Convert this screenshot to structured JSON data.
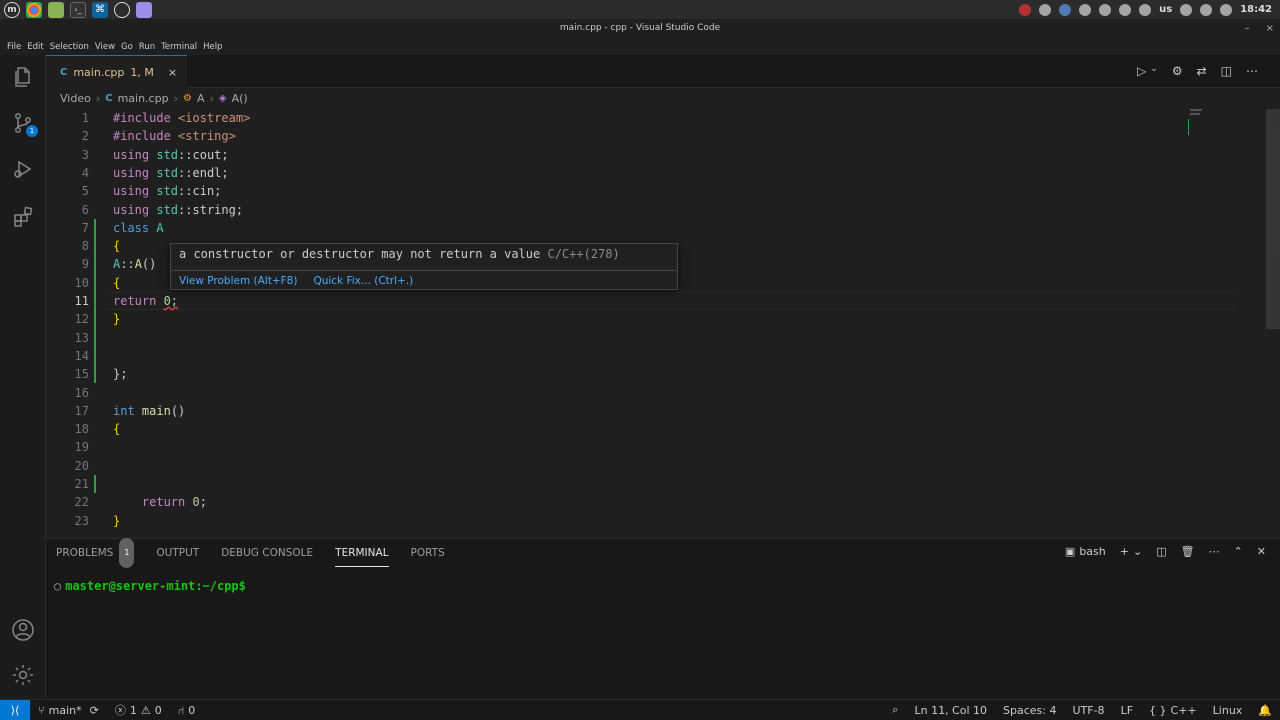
{
  "os_panel": {
    "clock": "18:42",
    "keyboard_layout": "us",
    "apps": [
      "mint-menu-icon",
      "chrome-icon",
      "files-icon",
      "terminal-icon",
      "vscode-icon",
      "obs-icon",
      "notes-icon"
    ]
  },
  "window": {
    "title": "main.cpp - cpp - Visual Studio Code",
    "minimize": "–",
    "close": "×"
  },
  "menu": [
    "File",
    "Edit",
    "Selection",
    "View",
    "Go",
    "Run",
    "Terminal",
    "Help"
  ],
  "activity": {
    "scm_badge": "1",
    "items": [
      "explorer",
      "source-control",
      "run-and-debug",
      "extensions",
      "accounts",
      "manage"
    ]
  },
  "tab": {
    "icon": "C",
    "label": "main.cpp",
    "status": "1, M",
    "close": "×"
  },
  "breadcrumb": {
    "folder": "Video",
    "file": "main.cpp",
    "class": "A",
    "method": "A()"
  },
  "code": {
    "current_line": 11,
    "lines": [
      {
        "n": "1",
        "tokens": [
          {
            "t": "#include ",
            "c": "kw"
          },
          {
            "t": "<iostream>",
            "c": "str"
          }
        ]
      },
      {
        "n": "2",
        "tokens": [
          {
            "t": "#include ",
            "c": "kw"
          },
          {
            "t": "<string>",
            "c": "str"
          }
        ]
      },
      {
        "n": "3",
        "tokens": [
          {
            "t": "using ",
            "c": "kw"
          },
          {
            "t": "std",
            "c": "ns"
          },
          {
            "t": "::cout;",
            "c": "pun"
          }
        ]
      },
      {
        "n": "4",
        "tokens": [
          {
            "t": "using ",
            "c": "kw"
          },
          {
            "t": "std",
            "c": "ns"
          },
          {
            "t": "::endl;",
            "c": "pun"
          }
        ]
      },
      {
        "n": "5",
        "tokens": [
          {
            "t": "using ",
            "c": "kw"
          },
          {
            "t": "std",
            "c": "ns"
          },
          {
            "t": "::cin;",
            "c": "pun"
          }
        ]
      },
      {
        "n": "6",
        "tokens": [
          {
            "t": "using ",
            "c": "kw"
          },
          {
            "t": "std",
            "c": "ns"
          },
          {
            "t": "::string;",
            "c": "pun"
          }
        ]
      },
      {
        "n": "7",
        "tokens": [
          {
            "t": "class ",
            "c": "kw2"
          },
          {
            "t": "A",
            "c": "ns"
          }
        ]
      },
      {
        "n": "8",
        "tokens": [
          {
            "t": "{",
            "c": "br"
          }
        ]
      },
      {
        "n": "9",
        "tokens": [
          {
            "t": "A",
            "c": "ns"
          },
          {
            "t": "::",
            "c": "pun"
          },
          {
            "t": "A",
            "c": "fn"
          },
          {
            "t": "()",
            "c": "pun"
          }
        ]
      },
      {
        "n": "10",
        "tokens": [
          {
            "t": "{",
            "c": "br"
          }
        ]
      },
      {
        "n": "11",
        "tokens": [
          {
            "t": "return ",
            "c": "kw"
          },
          {
            "t": "0;",
            "c": "num"
          }
        ]
      },
      {
        "n": "12",
        "tokens": [
          {
            "t": "}",
            "c": "br"
          }
        ]
      },
      {
        "n": "13",
        "tokens": []
      },
      {
        "n": "14",
        "tokens": []
      },
      {
        "n": "15",
        "tokens": [
          {
            "t": "};",
            "c": "pun"
          }
        ]
      },
      {
        "n": "16",
        "tokens": []
      },
      {
        "n": "17",
        "tokens": [
          {
            "t": "int ",
            "c": "kw2"
          },
          {
            "t": "main",
            "c": "fn"
          },
          {
            "t": "()",
            "c": "pun"
          }
        ]
      },
      {
        "n": "18",
        "tokens": [
          {
            "t": "{",
            "c": "br"
          }
        ]
      },
      {
        "n": "19",
        "tokens": []
      },
      {
        "n": "20",
        "tokens": []
      },
      {
        "n": "21",
        "tokens": []
      },
      {
        "n": "22",
        "tokens": [
          {
            "t": "    return ",
            "c": "kw"
          },
          {
            "t": "0",
            "c": "num"
          },
          {
            "t": ";",
            "c": "pun"
          }
        ]
      },
      {
        "n": "23",
        "tokens": [
          {
            "t": "}",
            "c": "br"
          }
        ]
      }
    ]
  },
  "hover": {
    "message": "a constructor or destructor may not return a value",
    "code": "C/C++(278)",
    "view_problem": "View Problem (Alt+F8)",
    "quick_fix": "Quick Fix... (Ctrl+.)"
  },
  "panel": {
    "tabs": [
      {
        "label": "PROBLEMS",
        "badge": "1"
      },
      {
        "label": "OUTPUT"
      },
      {
        "label": "DEBUG CONSOLE"
      },
      {
        "label": "TERMINAL",
        "active": true
      },
      {
        "label": "PORTS"
      }
    ],
    "shell": "bash",
    "prompt": "master@server-mint:~/cpp$"
  },
  "status": {
    "branch": "main*",
    "errors": "1",
    "warnings": "0",
    "ports": "0",
    "position": "Ln 11, Col 10",
    "spaces": "Spaces: 4",
    "encoding": "UTF-8",
    "eol": "LF",
    "language": "C++",
    "os": "Linux"
  },
  "colors": {
    "accent": "#0078d4",
    "git_added": "#2ea043",
    "link": "#4daafc"
  }
}
